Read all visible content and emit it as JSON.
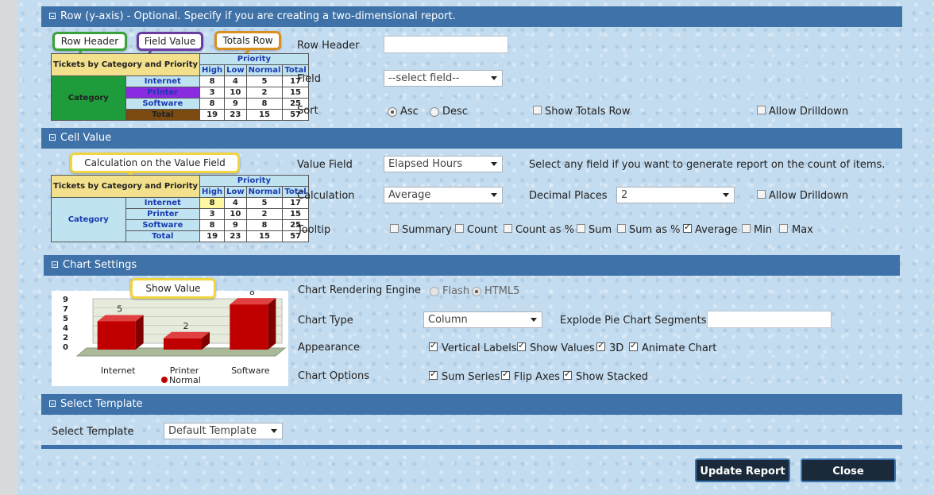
{
  "row_section": {
    "header": "Row (y-axis) - Optional. Specify if you are creating a two-dimensional report.",
    "callouts": [
      "Row Header",
      "Field Value",
      "Totals Row"
    ],
    "row_header_label": "Row Header",
    "row_header_value": "",
    "field_label": "Field",
    "field_value": "--select field--",
    "sort_label": "Sort",
    "sort_options": [
      "Asc",
      "Desc"
    ],
    "sort_selected": "Asc",
    "show_totals_label": "Show Totals Row",
    "allow_drilldown_label": "Allow Drilldown"
  },
  "example_table": {
    "title": "Tickets by Category and Priority",
    "priority": "Priority",
    "columns": [
      "High",
      "Low",
      "Normal",
      "Total"
    ],
    "category": "Category",
    "rows": [
      {
        "label": "Internet",
        "values": [
          "8",
          "4",
          "5",
          "17"
        ]
      },
      {
        "label": "Printer",
        "values": [
          "3",
          "10",
          "2",
          "15"
        ]
      },
      {
        "label": "Software",
        "values": [
          "8",
          "9",
          "8",
          "25"
        ]
      },
      {
        "label": "Total",
        "values": [
          "19",
          "23",
          "15",
          "57"
        ]
      }
    ]
  },
  "cell_section": {
    "header": "Cell Value",
    "callout": "Calculation on the Value Field",
    "value_field_label": "Value Field",
    "value_field_value": "Elapsed Hours",
    "value_field_hint": "Select any field if you want to generate report on the count of items.",
    "calculation_label": "Calculation",
    "calculation_value": "Average",
    "decimal_places_label": "Decimal Places",
    "decimal_places_value": "2",
    "allow_drilldown_label": "Allow Drilldown",
    "tooltip_label": "Tooltip",
    "tooltip_options": [
      {
        "label": "Summary",
        "checked": false
      },
      {
        "label": "Count",
        "checked": false
      },
      {
        "label": "Count as %",
        "checked": false
      },
      {
        "label": "Sum",
        "checked": false
      },
      {
        "label": "Sum as %",
        "checked": false
      },
      {
        "label": "Average",
        "checked": true
      },
      {
        "label": "Min",
        "checked": false
      },
      {
        "label": "Max",
        "checked": false
      }
    ]
  },
  "chart_section": {
    "header": "Chart Settings",
    "callout": "Show Value",
    "engine_label": "Chart Rendering Engine",
    "engine_options": [
      "Flash",
      "HTML5"
    ],
    "engine_selected": "HTML5",
    "chart_type_label": "Chart Type",
    "chart_type_value": "Column",
    "explode_label": "Explode Pie Chart Segments",
    "explode_value": "",
    "appearance_label": "Appearance",
    "appearance_options": [
      {
        "label": "Vertical Labels",
        "checked": true
      },
      {
        "label": "Show Values",
        "checked": true
      },
      {
        "label": "3D",
        "checked": true
      },
      {
        "label": "Animate Chart",
        "checked": true
      }
    ],
    "chart_options_label": "Chart Options",
    "chart_options": [
      {
        "label": "Sum Series",
        "checked": true
      },
      {
        "label": "Flip Axes",
        "checked": true
      },
      {
        "label": "Show Stacked",
        "checked": true
      }
    ]
  },
  "preview_chart": {
    "y_ticks": [
      "9",
      "7",
      "5",
      "4",
      "2",
      "0"
    ],
    "legend": "Normal",
    "series_color": "#c00000"
  },
  "chart_data": {
    "type": "bar",
    "categories": [
      "Internet",
      "Printer",
      "Software"
    ],
    "series": [
      {
        "name": "Normal",
        "values": [
          5,
          2,
          8
        ]
      }
    ],
    "data_labels": [
      "5",
      "2",
      "8"
    ],
    "ylim": [
      0,
      9
    ]
  },
  "template_section": {
    "header": "Select Template",
    "label": "Select Template",
    "value": "Default Template"
  },
  "buttons": {
    "update": "Update Report",
    "close": "Close"
  }
}
